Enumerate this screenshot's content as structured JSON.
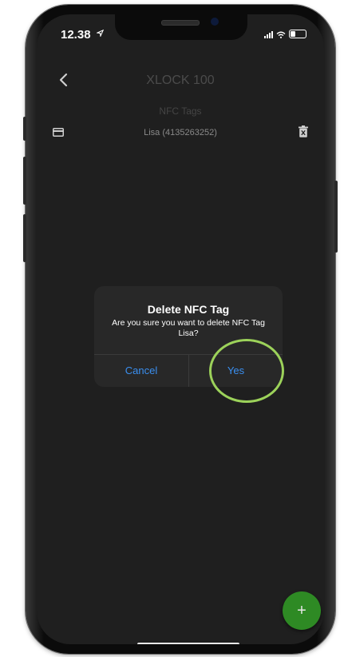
{
  "status_bar": {
    "time": "12.38",
    "location_icon": "location-arrow-icon",
    "signal_icon": "signal-icon",
    "wifi_icon": "wifi-icon",
    "battery_icon": "battery-icon"
  },
  "header": {
    "back_icon": "chevron-left-icon",
    "title": "XLOCK 100"
  },
  "section": {
    "title": "NFC Tags"
  },
  "nfc_tags": [
    {
      "icon": "card-icon",
      "label": "Lisa (4135263252)",
      "delete_icon": "trash-icon"
    }
  ],
  "dialog": {
    "title": "Delete NFC Tag",
    "message": "Are you sure you want to delete NFC Tag Lisa?",
    "cancel_label": "Cancel",
    "confirm_label": "Yes"
  },
  "fab": {
    "label": "+",
    "icon": "plus-icon"
  },
  "colors": {
    "background": "#1f1f1f",
    "dialog": "#282828",
    "accent_blue": "#3a8ff0",
    "fab_green": "#2e8a24",
    "highlight_ring": "#9cd25a"
  }
}
